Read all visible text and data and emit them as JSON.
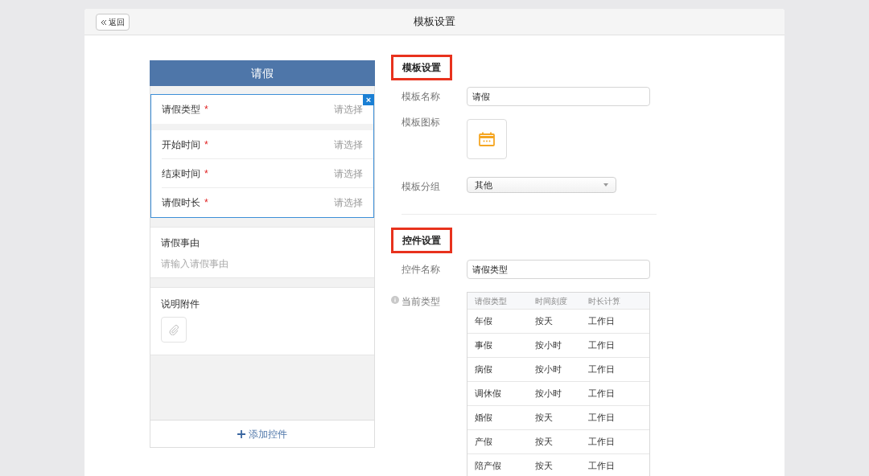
{
  "header": {
    "back": "返回",
    "title": "模板设置"
  },
  "preview": {
    "title": "请假",
    "blocks": [
      {
        "selected": true,
        "close": "×",
        "sections": [
          [
            {
              "kind": "select",
              "label": "请假类型",
              "required_mark": "*",
              "placeholder": "请选择"
            }
          ],
          [
            {
              "kind": "select",
              "label": "开始时间",
              "required_mark": "*",
              "placeholder": "请选择"
            },
            {
              "kind": "select",
              "label": "结束时间",
              "required_mark": "*",
              "placeholder": "请选择"
            },
            {
              "kind": "select",
              "label": "请假时长",
              "required_mark": "*",
              "placeholder": "请选择"
            }
          ]
        ]
      },
      {
        "selected": false,
        "sections": [
          [
            {
              "kind": "textarea",
              "label": "请假事由",
              "placeholder": "请输入请假事由"
            }
          ]
        ]
      },
      {
        "selected": false,
        "sections": [
          [
            {
              "kind": "attachment",
              "label": "说明附件"
            }
          ]
        ]
      }
    ],
    "add_button": "添加控件"
  },
  "settings": [
    {
      "title": "模板设置",
      "highlighted": true,
      "rows": [
        {
          "kind": "text",
          "label": "模板名称",
          "value": "请假"
        },
        {
          "kind": "icon",
          "label": "模板图标"
        },
        {
          "kind": "select",
          "label": "模板分组",
          "value": "其他"
        }
      ]
    },
    {
      "title": "控件设置",
      "highlighted": true,
      "rows": [
        {
          "kind": "text",
          "label": "控件名称",
          "value": "请假类型"
        },
        {
          "kind": "table",
          "label": "当前类型",
          "columns": [
            "请假类型",
            "时间刻度",
            "时长计算"
          ],
          "rows": [
            [
              "年假",
              "按天",
              "工作日"
            ],
            [
              "事假",
              "按小时",
              "工作日"
            ],
            [
              "病假",
              "按小时",
              "工作日"
            ],
            [
              "调休假",
              "按小时",
              "工作日"
            ],
            [
              "婚假",
              "按天",
              "工作日"
            ],
            [
              "产假",
              "按天",
              "工作日"
            ],
            [
              "陪产假",
              "按天",
              "工作日"
            ]
          ]
        }
      ]
    }
  ]
}
